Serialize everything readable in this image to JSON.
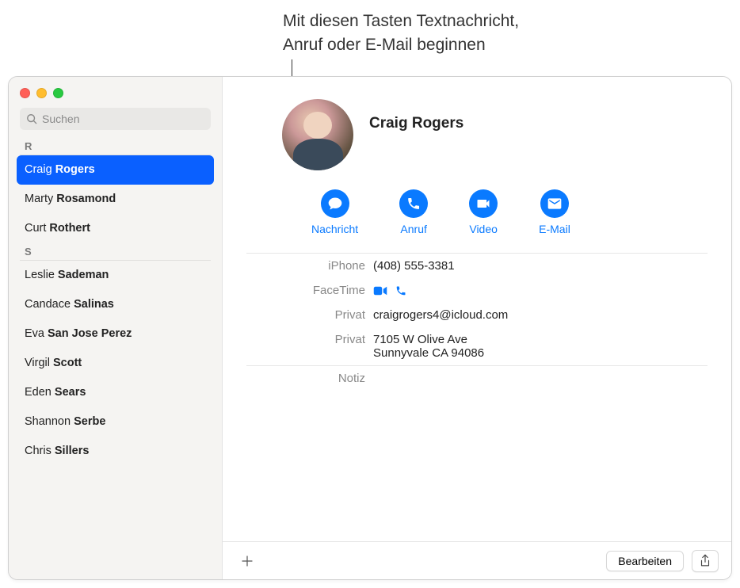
{
  "annotation": {
    "line1": "Mit diesen Tasten Textnachricht,",
    "line2": "Anruf oder E-Mail beginnen"
  },
  "search": {
    "placeholder": "Suchen"
  },
  "sections": [
    {
      "letter": "R",
      "items": [
        {
          "first": "Craig",
          "last": "Rogers",
          "selected": true
        },
        {
          "first": "Marty",
          "last": "Rosamond",
          "selected": false
        },
        {
          "first": "Curt",
          "last": "Rothert",
          "selected": false
        }
      ]
    },
    {
      "letter": "S",
      "items": [
        {
          "first": "Leslie",
          "last": "Sademan",
          "selected": false
        },
        {
          "first": "Candace",
          "last": "Salinas",
          "selected": false
        },
        {
          "first": "Eva",
          "last": "San Jose Perez",
          "selected": false
        },
        {
          "first": "Virgil",
          "last": "Scott",
          "selected": false
        },
        {
          "first": "Eden",
          "last": "Sears",
          "selected": false
        },
        {
          "first": "Shannon",
          "last": "Serbe",
          "selected": false
        },
        {
          "first": "Chris",
          "last": "Sillers",
          "selected": false
        }
      ]
    }
  ],
  "contact": {
    "name": "Craig Rogers"
  },
  "actions": {
    "message": "Nachricht",
    "call": "Anruf",
    "video": "Video",
    "mail": "E-Mail"
  },
  "details": {
    "phone_label": "iPhone",
    "phone_value": "(408) 555-3381",
    "facetime_label": "FaceTime",
    "email_label": "Privat",
    "email_value": "craigrogers4@icloud.com",
    "address_label": "Privat",
    "address_line1": "7105 W Olive Ave",
    "address_line2": "Sunnyvale CA 94086",
    "note_label": "Notiz"
  },
  "buttons": {
    "edit": "Bearbeiten"
  }
}
